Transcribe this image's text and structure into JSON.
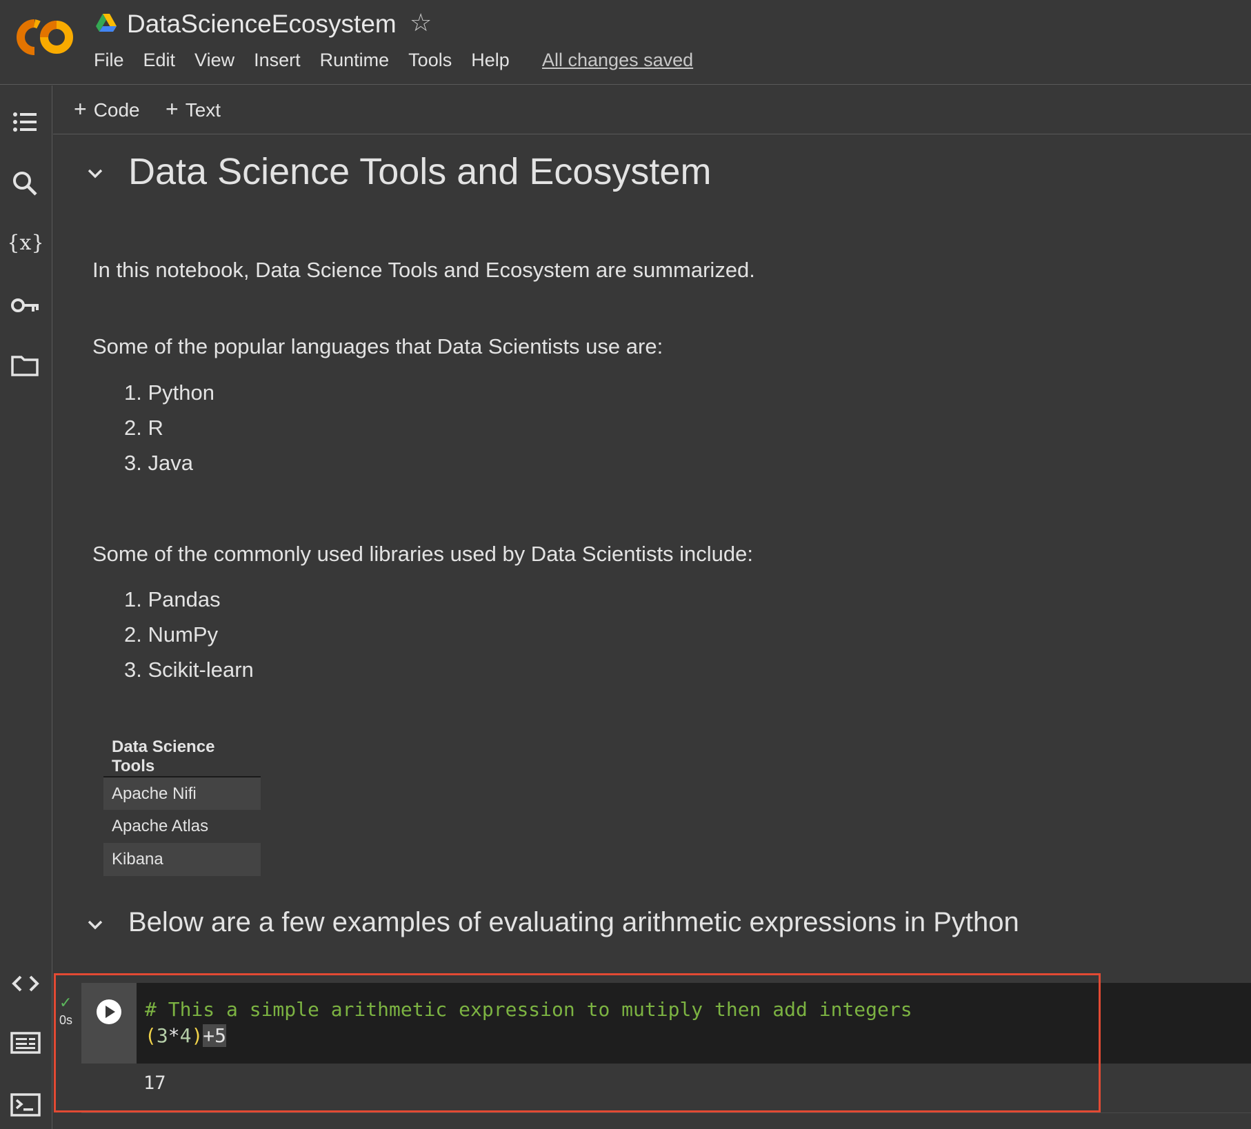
{
  "header": {
    "doc_title": "DataScienceEcosystem",
    "saved_status": "All changes saved",
    "menu": [
      "File",
      "Edit",
      "View",
      "Insert",
      "Runtime",
      "Tools",
      "Help"
    ]
  },
  "toolbar": {
    "code_label": "Code",
    "text_label": "Text"
  },
  "rail": {
    "icons": [
      "toc-icon",
      "search-icon",
      "variables-icon",
      "key-icon",
      "folder-icon",
      "code-snippets-icon",
      "command-palette-icon",
      "terminal-icon"
    ]
  },
  "content": {
    "heading1": "Data Science Tools and Ecosystem",
    "intro": "In this notebook, Data Science Tools and Ecosystem are summarized.",
    "languages_intro": "Some of the popular languages that Data Scientists use are:",
    "languages": [
      "1. Python",
      "2. R",
      "3. Java"
    ],
    "libraries_intro": "Some of the commonly used libraries used by Data Scientists include:",
    "libraries": [
      "1. Pandas",
      "2. NumPy",
      "3. Scikit-learn"
    ],
    "table": {
      "header": "Data Science Tools",
      "rows": [
        "Apache Nifi",
        "Apache Atlas",
        "Kibana"
      ]
    },
    "heading2": "Below are a few examples of evaluating arithmetic expressions in Python"
  },
  "cell": {
    "exec_time": "0s",
    "code_comment": "# This a simple arithmetic expression to mutiply then add integers",
    "code_expr_paren_open": "(",
    "code_expr_a": "3",
    "code_expr_op": "*",
    "code_expr_b": "4",
    "code_expr_paren_close": ")",
    "code_expr_tail": "+5",
    "output": "17"
  },
  "colors": {
    "background": "#383838",
    "code_bg": "#1e1e1e",
    "comment": "#7cb342",
    "highlight": "#e24a33",
    "logo_orange": "#f9ab00",
    "logo_dark_orange": "#e37400"
  }
}
